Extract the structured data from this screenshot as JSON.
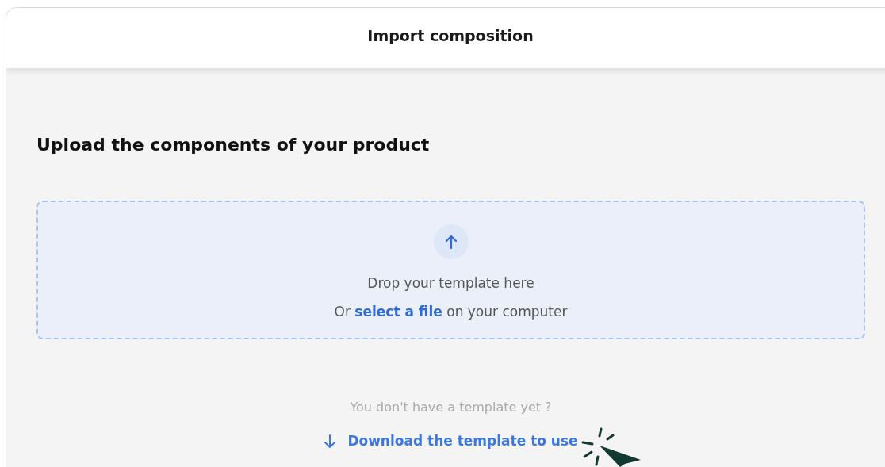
{
  "dialog": {
    "title": "Import composition"
  },
  "heading": "Upload the components of your product",
  "dropzone": {
    "primary_text": "Drop your template here",
    "secondary_text": "Or **select a file** on your computer"
  },
  "template_prompt": "You don't have a template yet ?",
  "download_link": "Download the template to use"
}
